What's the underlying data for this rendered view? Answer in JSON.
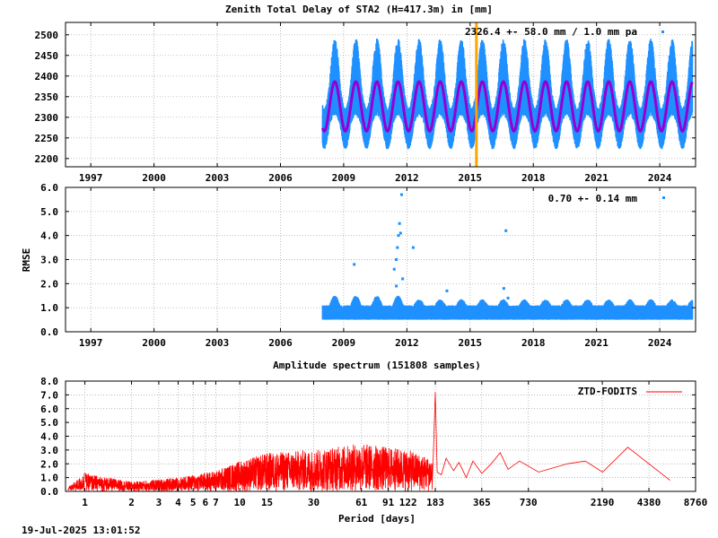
{
  "timestamp": "19-Jul-2025 13:01:52",
  "chart_data": [
    {
      "type": "scatter",
      "title": "Zenith Total Delay of STA2 (H=417.3m) in [mm]",
      "xlabel": "",
      "ylabel": "",
      "xlim": [
        1995.8,
        2025.7
      ],
      "ylim": [
        2180,
        2530
      ],
      "x_ticks": [
        1997,
        2000,
        2003,
        2006,
        2009,
        2012,
        2015,
        2018,
        2021,
        2024
      ],
      "y_ticks": [
        2200,
        2250,
        2300,
        2350,
        2400,
        2450,
        2500
      ],
      "grid": true,
      "legend_position": "top-right",
      "legend_text": "2326.4 +-  58.0 mm /  1.0 mm pa",
      "data_start": 2008.0,
      "data_end": 2025.55,
      "mean": 2326.4,
      "seasonal_amplitude": 60,
      "data_min": 2180,
      "data_max": 2500,
      "break_epoch": 2015.3,
      "colors": {
        "points": "#1e90ff",
        "model": "#9400d3",
        "break": "#ffa500"
      }
    },
    {
      "type": "scatter",
      "title": "",
      "xlabel": "",
      "ylabel": "RMSE",
      "xlim": [
        1995.8,
        2025.7
      ],
      "ylim": [
        0,
        6
      ],
      "x_ticks": [
        1997,
        2000,
        2003,
        2006,
        2009,
        2012,
        2015,
        2018,
        2021,
        2024
      ],
      "y_ticks": [
        0.0,
        1.0,
        2.0,
        3.0,
        4.0,
        5.0,
        6.0
      ],
      "y_tick_labels": [
        "0.0",
        "1.0",
        "2.0",
        "3.0",
        "4.0",
        "5.0",
        "6.0"
      ],
      "grid": true,
      "legend_position": "top-right",
      "legend_text": "0.70 +-  0.14 mm",
      "data_start": 2008.0,
      "data_end": 2025.55,
      "typical_range": [
        0.5,
        1.2
      ],
      "outliers": [
        {
          "x": 2009.5,
          "y": 2.8
        },
        {
          "x": 2011.4,
          "y": 2.6
        },
        {
          "x": 2011.5,
          "y": 3.0
        },
        {
          "x": 2011.55,
          "y": 3.5
        },
        {
          "x": 2011.6,
          "y": 4.0
        },
        {
          "x": 2011.7,
          "y": 4.1
        },
        {
          "x": 2011.65,
          "y": 4.5
        },
        {
          "x": 2011.75,
          "y": 5.7
        },
        {
          "x": 2011.8,
          "y": 2.2
        },
        {
          "x": 2011.5,
          "y": 1.9
        },
        {
          "x": 2012.3,
          "y": 3.5
        },
        {
          "x": 2016.7,
          "y": 4.2
        },
        {
          "x": 2016.6,
          "y": 1.8
        },
        {
          "x": 2013.9,
          "y": 1.7
        },
        {
          "x": 2016.8,
          "y": 1.4
        }
      ],
      "colors": {
        "points": "#1e90ff"
      }
    },
    {
      "type": "line",
      "title": "Amplitude spectrum (151808 samples)",
      "xlabel": "Period [days]",
      "ylabel": "",
      "xscale": "log",
      "xlim": [
        0.75,
        8760
      ],
      "ylim": [
        0,
        8
      ],
      "x_ticks": [
        1,
        2,
        3,
        4,
        5,
        6,
        7,
        10,
        15,
        30,
        61,
        91,
        122,
        183,
        365,
        730,
        2190,
        4380,
        8760
      ],
      "x_tick_labels": [
        "1",
        "2",
        "3",
        "4",
        "5",
        "6",
        "7",
        "10",
        "15",
        "30",
        "61",
        "91",
        "122",
        "183",
        "365",
        "730",
        "2190",
        "4380",
        "8760"
      ],
      "y_ticks": [
        0.0,
        1.0,
        2.0,
        3.0,
        4.0,
        5.0,
        6.0,
        7.0,
        8.0
      ],
      "y_tick_labels": [
        "0.0",
        "1.0",
        "2.0",
        "3.0",
        "4.0",
        "5.0",
        "6.0",
        "7.0",
        "8.0"
      ],
      "grid": true,
      "legend_position": "top-right",
      "series": [
        {
          "name": "ZTD-FODITS",
          "color": "#ff0000",
          "envelope": [
            {
              "x": 0.78,
              "y": 0.3
            },
            {
              "x": 1,
              "y": 1.3
            },
            {
              "x": 2,
              "y": 0.7
            },
            {
              "x": 4,
              "y": 1.0
            },
            {
              "x": 7,
              "y": 1.5
            },
            {
              "x": 10,
              "y": 2.2
            },
            {
              "x": 15,
              "y": 2.8
            },
            {
              "x": 30,
              "y": 3.0
            },
            {
              "x": 61,
              "y": 3.5
            },
            {
              "x": 122,
              "y": 3.0
            },
            {
              "x": 175,
              "y": 2.4
            }
          ],
          "points": [
            {
              "x": 178,
              "y": 3.0
            },
            {
              "x": 183,
              "y": 7.2
            },
            {
              "x": 188,
              "y": 1.4
            },
            {
              "x": 200,
              "y": 1.2
            },
            {
              "x": 215,
              "y": 2.4
            },
            {
              "x": 240,
              "y": 1.5
            },
            {
              "x": 260,
              "y": 2.1
            },
            {
              "x": 290,
              "y": 1.0
            },
            {
              "x": 320,
              "y": 2.2
            },
            {
              "x": 365,
              "y": 1.3
            },
            {
              "x": 420,
              "y": 2.0
            },
            {
              "x": 480,
              "y": 2.8
            },
            {
              "x": 540,
              "y": 1.6
            },
            {
              "x": 640,
              "y": 2.2
            },
            {
              "x": 850,
              "y": 1.4
            },
            {
              "x": 1300,
              "y": 2.0
            },
            {
              "x": 1700,
              "y": 2.2
            },
            {
              "x": 2200,
              "y": 1.4
            },
            {
              "x": 3200,
              "y": 3.2
            },
            {
              "x": 6000,
              "y": 0.8
            }
          ]
        }
      ]
    }
  ]
}
